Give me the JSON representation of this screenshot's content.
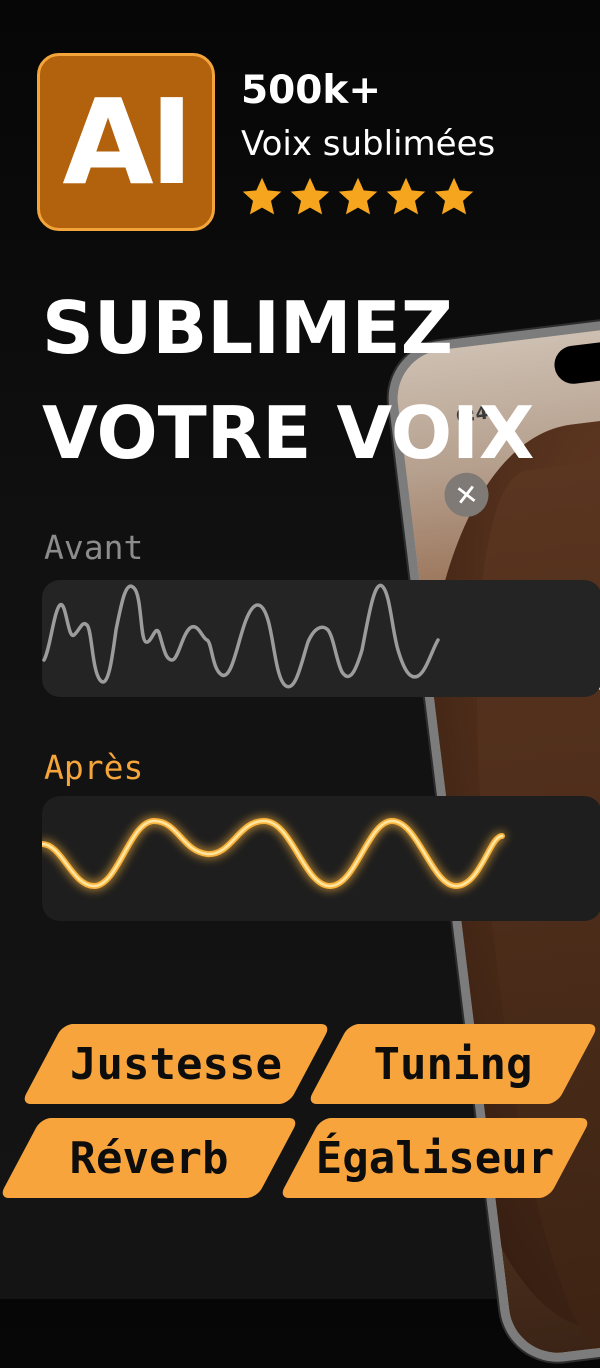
{
  "badge": {
    "text": "AI"
  },
  "stats": {
    "count": "500k+",
    "label": "Voix sublimées",
    "rating_stars": 5
  },
  "headline": {
    "line1": "SUBLIMEZ",
    "line2": "VOTRE VOIX"
  },
  "comparison": {
    "before_label": "Avant",
    "after_label": "Après"
  },
  "phone": {
    "time": "6:4",
    "close_glyph": "✕"
  },
  "features": [
    {
      "label": "Justesse"
    },
    {
      "label": "Tuning"
    },
    {
      "label": "Réverb"
    },
    {
      "label": "Égaliseur"
    }
  ],
  "colors": {
    "accent": "#f8a43d",
    "badge_bg": "#b2620c",
    "star": "#f6a51e",
    "background": "#0b0b0b"
  }
}
